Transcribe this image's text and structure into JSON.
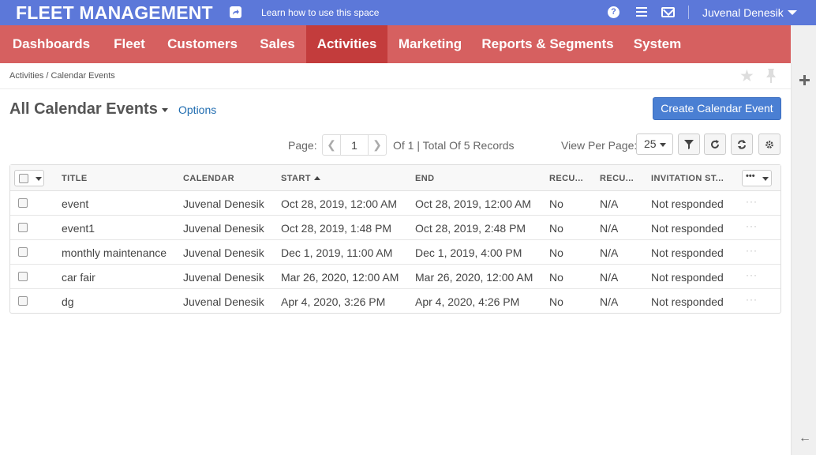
{
  "topbar": {
    "brand": "FLEET MANAGEMENT",
    "learn": "Learn how to use this space",
    "user": "Juvenal Denesik",
    "help_glyph": "?"
  },
  "nav": {
    "items": [
      "Dashboards",
      "Fleet",
      "Customers",
      "Sales",
      "Activities",
      "Marketing",
      "Reports & Segments",
      "System"
    ],
    "active": "Activities"
  },
  "breadcrumb": [
    "Activities",
    "Calendar Events"
  ],
  "page": {
    "title": "All Calendar Events",
    "options": "Options",
    "create": "Create Calendar Event"
  },
  "pager": {
    "label": "Page:",
    "current": "1",
    "info": "Of 1 | Total Of 5 Records",
    "view_per_page_label": "View Per Page:",
    "per_page": "25"
  },
  "grid": {
    "columns": [
      "TITLE",
      "CALENDAR",
      "START",
      "END",
      "RECU...",
      "RECU...",
      "INVITATION ST..."
    ],
    "sorted_column": "START",
    "sort_direction": "ascending",
    "rows": [
      {
        "title": "event",
        "calendar": "Juvenal Denesik",
        "start": "Oct 28, 2019, 12:00 AM",
        "end": "Oct 28, 2019, 12:00 AM",
        "recurring": "No",
        "recurrence": "N/A",
        "invitation": "Not responded"
      },
      {
        "title": "event1",
        "calendar": "Juvenal Denesik",
        "start": "Oct 28, 2019, 1:48 PM",
        "end": "Oct 28, 2019, 2:48 PM",
        "recurring": "No",
        "recurrence": "N/A",
        "invitation": "Not responded"
      },
      {
        "title": "monthly maintenance",
        "calendar": "Juvenal Denesik",
        "start": "Dec 1, 2019, 11:00 AM",
        "end": "Dec 1, 2019, 4:00 PM",
        "recurring": "No",
        "recurrence": "N/A",
        "invitation": "Not responded"
      },
      {
        "title": "car fair",
        "calendar": "Juvenal Denesik",
        "start": "Mar 26, 2020, 12:00 AM",
        "end": "Mar 26, 2020, 12:00 AM",
        "recurring": "No",
        "recurrence": "N/A",
        "invitation": "Not responded"
      },
      {
        "title": "dg",
        "calendar": "Juvenal Denesik",
        "start": "Apr 4, 2020, 3:26 PM",
        "end": "Apr 4, 2020, 4:26 PM",
        "recurring": "No",
        "recurrence": "N/A",
        "invitation": "Not responded"
      }
    ]
  },
  "icons": {
    "share": "share-icon",
    "help": "help-icon",
    "menu": "hamburger-menu-icon",
    "mail": "mail-icon",
    "star": "star-icon",
    "pin": "pin-icon",
    "filter": "filter-icon",
    "refresh": "refresh-icon",
    "reset": "reset-icon",
    "settings": "gear-icon",
    "plus": "plus-icon",
    "back": "arrow-left-icon"
  },
  "colors": {
    "topbar": "#5c78d9",
    "navbar": "#d66060",
    "nav_active": "#c33c3c",
    "primary_button": "#4a7fd3",
    "link": "#1f6cb0"
  }
}
